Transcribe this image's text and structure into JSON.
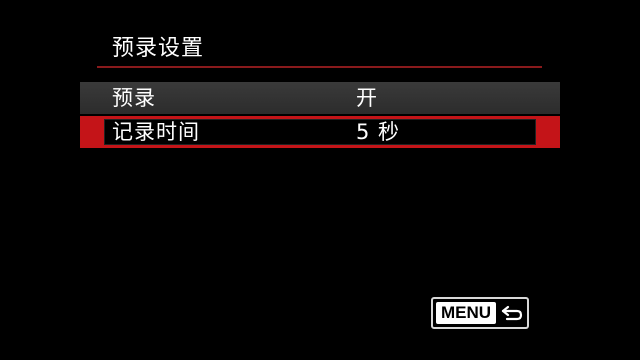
{
  "screen": {
    "title": "预录设置"
  },
  "menu": {
    "items": [
      {
        "label": "预录",
        "value": "开",
        "selected": false
      },
      {
        "label": "记录时间",
        "value": "5 秒",
        "selected": true
      }
    ]
  },
  "footer": {
    "menu_button_label": "MENU",
    "return_icon": "return-arrow-icon"
  },
  "colors": {
    "background": "#000000",
    "selection_red": "#c41418",
    "row_gray": "#333333",
    "underline_red": "#8a1a1c"
  }
}
